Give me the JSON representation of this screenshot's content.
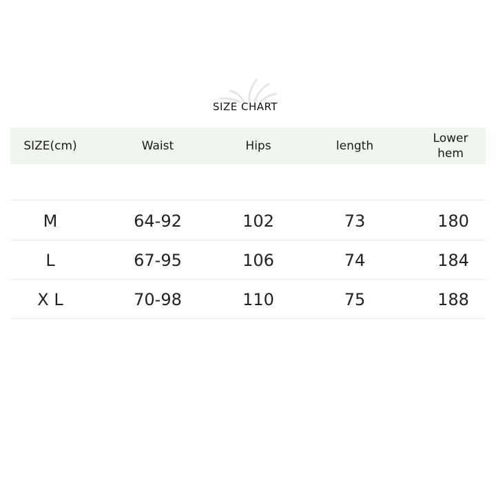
{
  "title": "SIZE CHART",
  "header": [
    "SIZE(cm)",
    "Waist",
    "Hips",
    "length",
    "Lower hem"
  ],
  "rows": [
    [
      "M",
      "64-92",
      "102",
      "73",
      "180"
    ],
    [
      "L",
      "67-95",
      "106",
      "74",
      "184"
    ],
    [
      "X L",
      "70-98",
      "110",
      "75",
      "188"
    ]
  ]
}
